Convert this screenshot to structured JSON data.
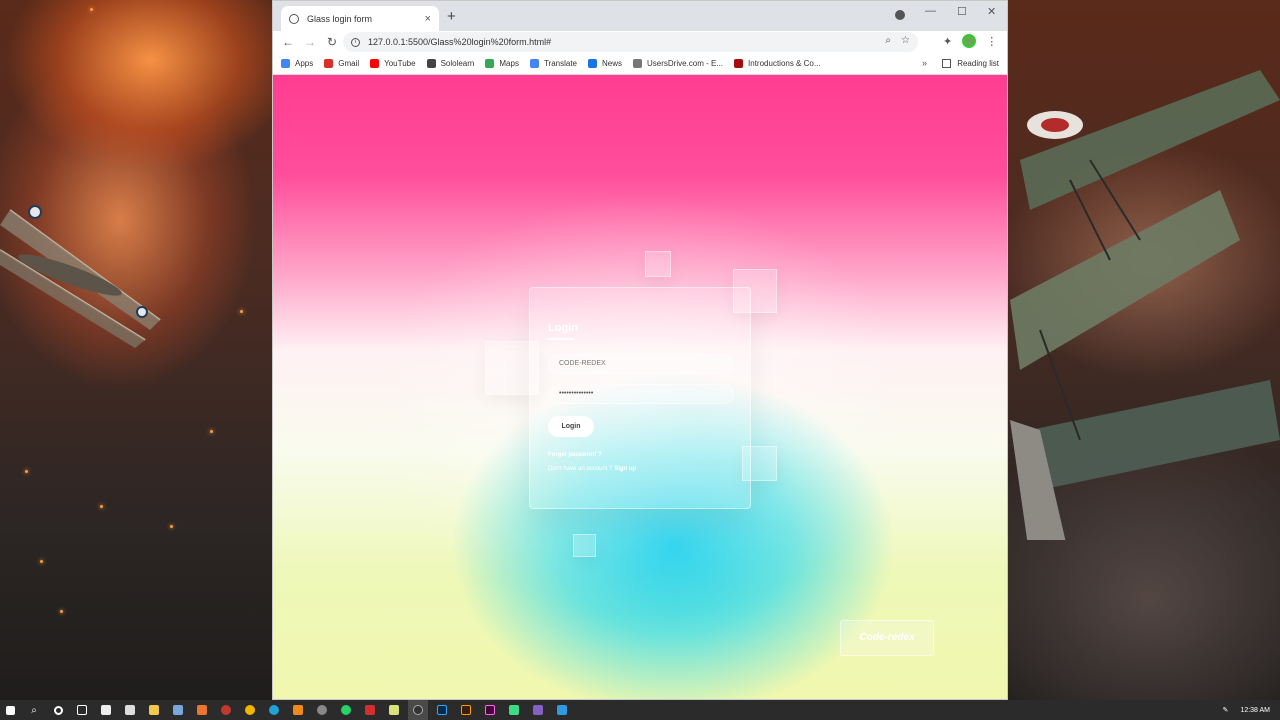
{
  "browser": {
    "tab_title": "Glass login form",
    "tab_close": "×",
    "new_tab": "+",
    "url": "127.0.0.1:5500/Glass%20login%20form.html#",
    "minimize": "—",
    "maximize": "☐",
    "close": "✕"
  },
  "bookmarks": [
    {
      "label": "Apps",
      "color": "#4285f4"
    },
    {
      "label": "Gmail",
      "color": "#d93025"
    },
    {
      "label": "YouTube",
      "color": "#ff0000"
    },
    {
      "label": "Sololearn",
      "color": "#444444"
    },
    {
      "label": "Maps",
      "color": "#34a853"
    },
    {
      "label": "Translate",
      "color": "#4285f4"
    },
    {
      "label": "News",
      "color": "#1a73e8"
    },
    {
      "label": "UsersDrive.com - E...",
      "color": "#777777"
    },
    {
      "label": "Introductions & Co...",
      "color": "#a50e0e"
    }
  ],
  "reading_list": "Reading list",
  "bookmarks_more": "»",
  "login_form": {
    "title": "Login",
    "username_value": "CODE-REDEX",
    "password_value": "••••••••••••••",
    "button_label": "Login",
    "forgot_text": "Forget password ?",
    "signup_prompt": "Don't have an account ?",
    "signup_link": "Sign up"
  },
  "brand_label": "Code-redex",
  "taskbar": {
    "time": "12:38 AM"
  },
  "colors": {
    "accent_pink": "#ff3d91",
    "accent_cyan": "#0ecdeb",
    "accent_yellow": "#f1f7ae"
  }
}
